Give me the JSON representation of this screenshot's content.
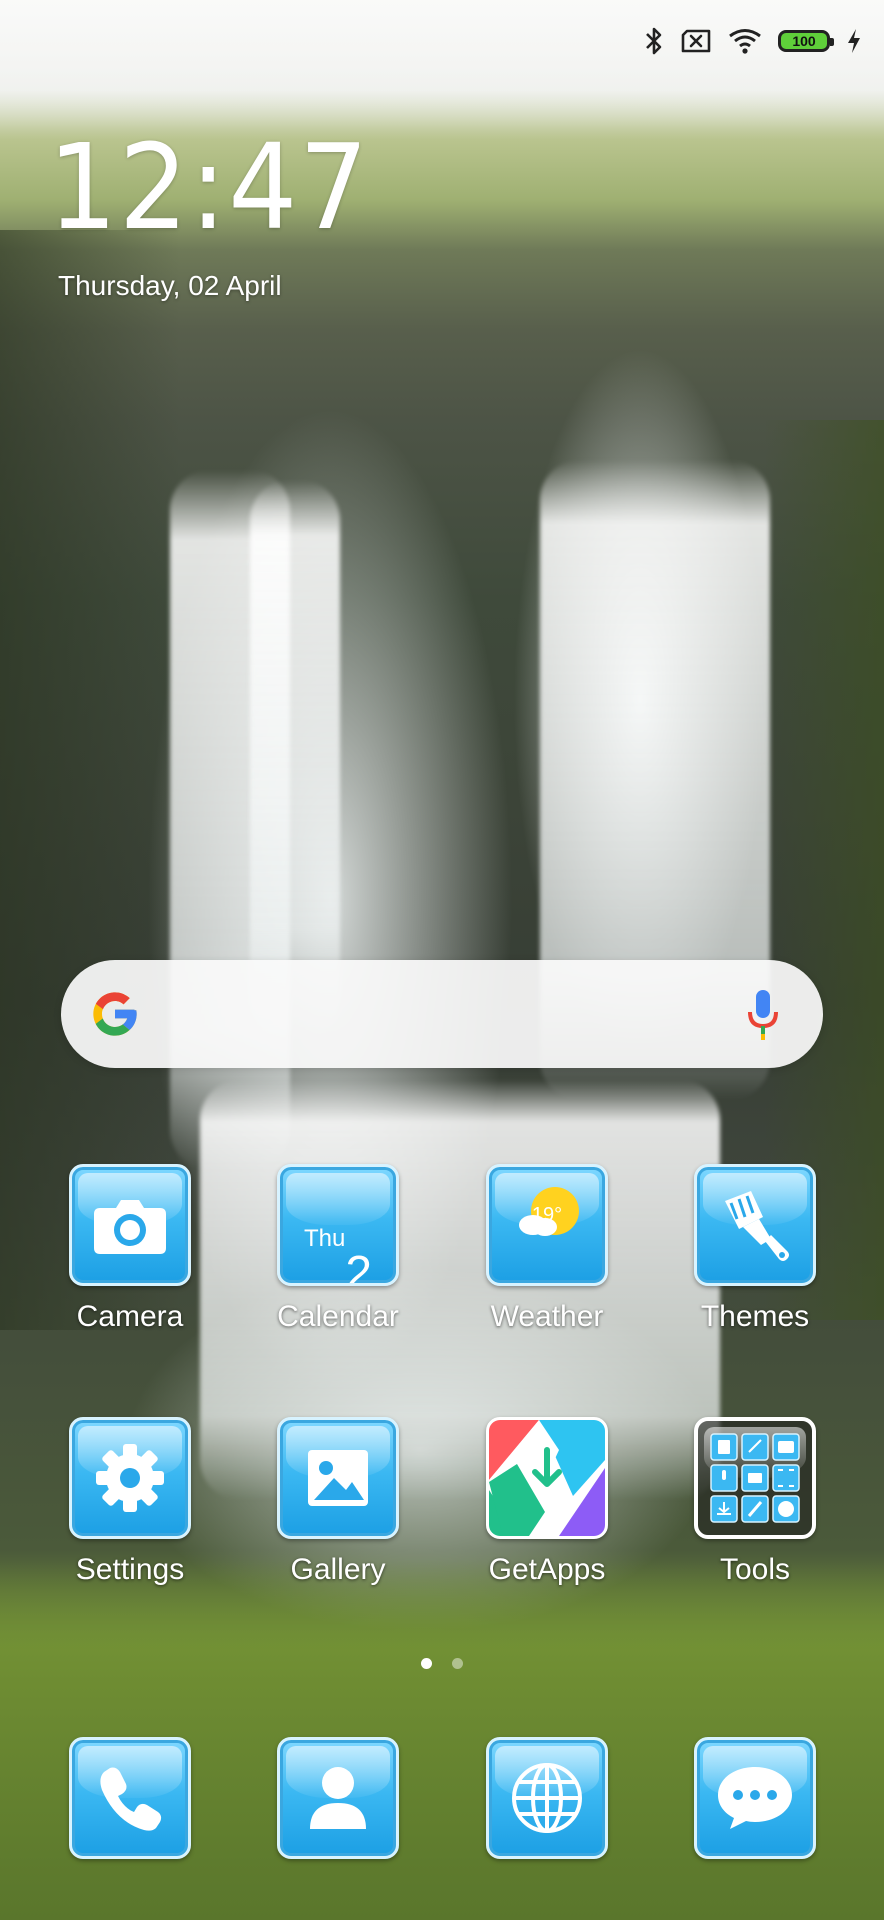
{
  "status_bar": {
    "icons": [
      "bluetooth-icon",
      "no-sim-icon",
      "wifi-icon",
      "battery-icon",
      "charging-icon"
    ],
    "battery_level": "100"
  },
  "clock": {
    "time": "12:47",
    "date": "Thursday, 02 April"
  },
  "search": {
    "logo": "google-g-icon",
    "mic": "mic-icon"
  },
  "apps_row1": [
    {
      "label": "Camera",
      "icon": "camera-icon"
    },
    {
      "label": "Calendar",
      "icon": "calendar-icon",
      "day": "Thu",
      "date": "2"
    },
    {
      "label": "Weather",
      "icon": "weather-icon",
      "temp": "19°"
    },
    {
      "label": "Themes",
      "icon": "brush-icon"
    }
  ],
  "apps_row2": [
    {
      "label": "Settings",
      "icon": "gear-icon"
    },
    {
      "label": "Gallery",
      "icon": "image-icon"
    },
    {
      "label": "GetApps",
      "icon": "getapps-icon"
    },
    {
      "label": "Tools",
      "icon": "tools-folder-icon"
    }
  ],
  "page_indicator": {
    "pages": 2,
    "current": 1
  },
  "dock": [
    {
      "icon": "phone-icon"
    },
    {
      "icon": "contacts-icon"
    },
    {
      "icon": "browser-icon"
    },
    {
      "icon": "messages-icon"
    }
  ],
  "colors": {
    "tile_blue": "#3bb8f2",
    "google_blue": "#4285F4",
    "google_red": "#EA4335",
    "google_yellow": "#FBBC05",
    "google_green": "#34A853",
    "battery_green": "#5fcf3a"
  }
}
